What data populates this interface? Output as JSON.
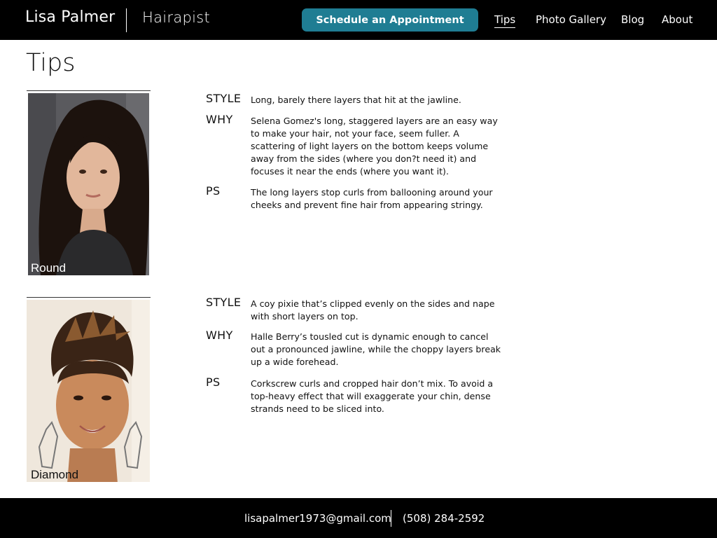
{
  "header": {
    "brand_name": "Lisa Palmer",
    "brand_subtitle": "Hairapist",
    "cta_label": "Schedule an Appointment",
    "nav": [
      {
        "label": "Tips",
        "active": true
      },
      {
        "label": "Photo Gallery",
        "active": false
      },
      {
        "label": "Blog",
        "active": false
      },
      {
        "label": "About",
        "active": false
      }
    ]
  },
  "page": {
    "title": "Tips"
  },
  "tips": [
    {
      "face_shape": "Round",
      "style_key": "STYLE",
      "style_text": "Long, barely there layers that hit at the jawline.",
      "why_key": "WHY",
      "why_text": "Selena Gomez's long, staggered layers are an easy way to make your hair, not your face, seem fuller. A scattering of light layers on the bottom keeps volume away from the sides (where you don?t need it) and focuses it near the ends (where you want it).",
      "ps_key": "PS",
      "ps_text": "The long layers stop curls from ballooning around your cheeks and prevent fine hair from appearing stringy."
    },
    {
      "face_shape": "Diamond",
      "style_key": "STYLE",
      "style_text": "A coy pixie that’s clipped evenly on the sides and nape with short layers on top.",
      "why_key": "WHY",
      "why_text": "Halle Berry’s tousled cut is dynamic enough to cancel out a pronounced jawline, while the choppy layers break up a wide forehead.",
      "ps_key": "PS",
      "ps_text": "Corkscrew curls and cropped hair don’t mix. To avoid a top-heavy effect that will exaggerate your chin, dense strands need to be sliced into."
    }
  ],
  "footer": {
    "email": "lisapalmer1973@gmail.com",
    "phone": "(508) 284-2592"
  },
  "colors": {
    "header_bg": "#000000",
    "cta_bg": "#1f7d93",
    "text": "#111111"
  }
}
